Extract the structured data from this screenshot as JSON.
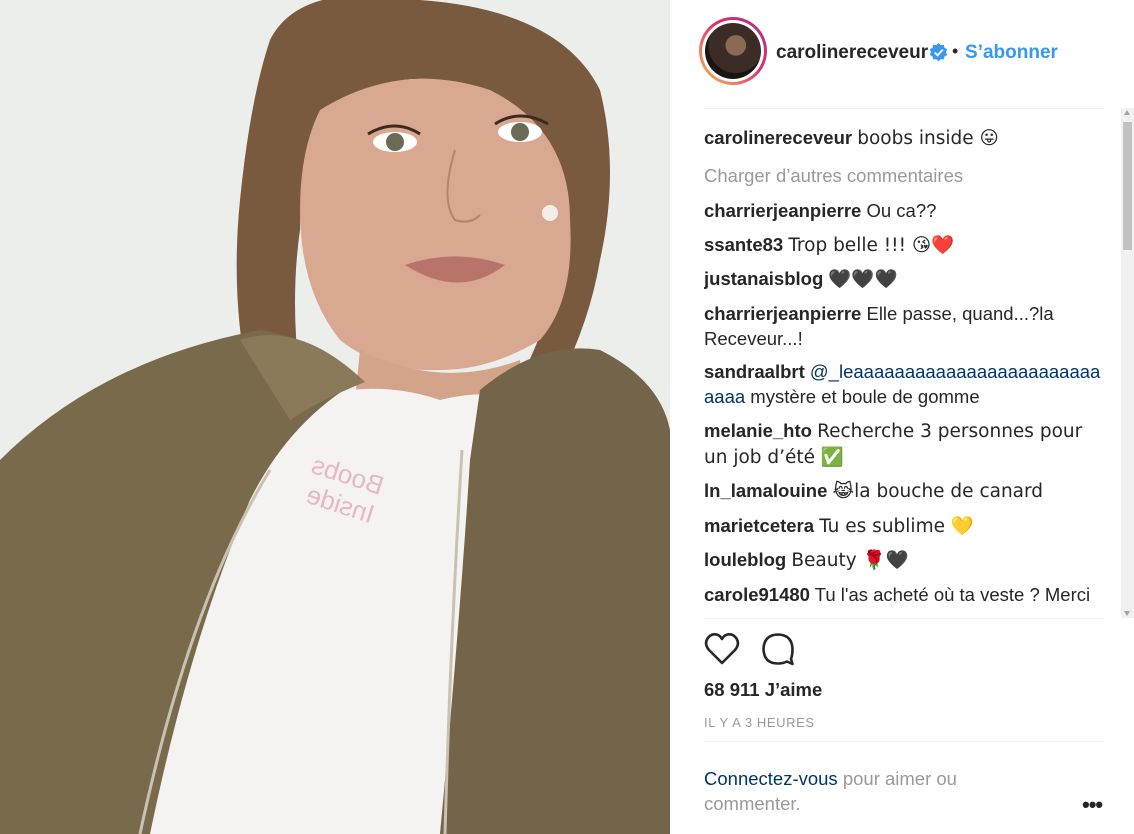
{
  "post": {
    "username": "carolinereceveur",
    "follow_label": "S’abonner",
    "dot": "•",
    "caption_text": "boobs inside 😛",
    "load_more": "Charger d’autres commentaires",
    "shirt_text_line1": "Boobs",
    "shirt_text_line2": "Inside"
  },
  "comments": [
    {
      "user": "charrierjeanpierre",
      "text": "Ou ca??"
    },
    {
      "user": "ssante83",
      "text": "Trop belle !!! 😘❤️"
    },
    {
      "user": "justanaisblog",
      "text": "🖤🖤🖤"
    },
    {
      "user": "charrierjeanpierre",
      "text": "Elle passe, quand...?la Receveur...!"
    },
    {
      "user": "sandraalbrt",
      "mention": "@_leaaaaaaaaaaaaaaaaaaaaaaaaaaaa",
      "text": " mystère et boule de gomme"
    },
    {
      "user": "melanie_hto",
      "text": "Recherche 3 personnes pour un job d’été ✅"
    },
    {
      "user": "ln_lamalouine",
      "text": "😹la bouche de canard"
    },
    {
      "user": "marietcetera",
      "text": "Tu es sublime 💛"
    },
    {
      "user": "louleblog",
      "text": "Beauty 🌹🖤"
    },
    {
      "user": "carole91480",
      "text": "Tu l'as acheté où ta veste ? Merci"
    }
  ],
  "stats": {
    "likes": "68 911 J’aime",
    "time": "IL Y A 3 HEURES"
  },
  "footer": {
    "login_link": "Connectez-vous",
    "login_rest": " pour aimer ou commenter.",
    "more_label": "•••"
  },
  "icons": {
    "like": "heart-outline-icon",
    "comment": "speech-bubble-icon",
    "verified": "verified-badge-icon"
  },
  "colors": {
    "accent": "#3897f0",
    "mention": "#003569",
    "muted": "#999999",
    "text": "#262626"
  }
}
